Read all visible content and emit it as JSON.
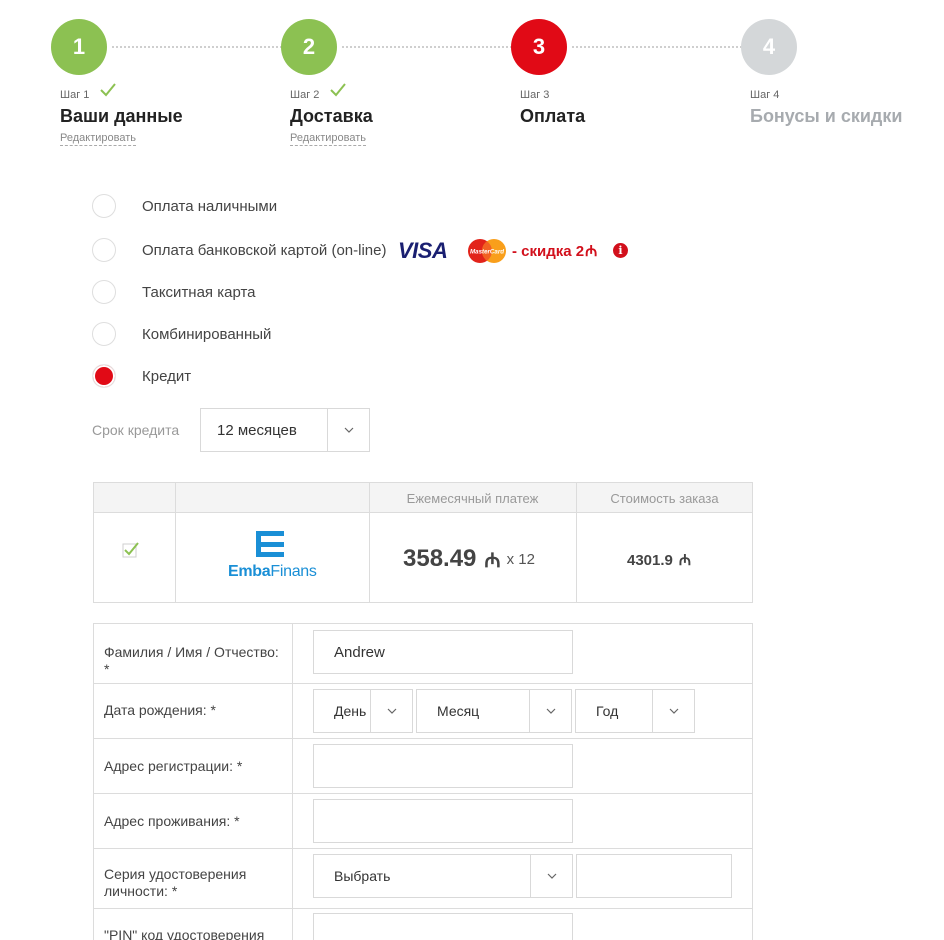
{
  "steps": [
    {
      "number": "1",
      "small": "Шаг 1",
      "title": "Ваши данные",
      "edit": "Редактировать",
      "state": "done"
    },
    {
      "number": "2",
      "small": "Шаг 2",
      "title": "Доставка",
      "edit": "Редактировать",
      "state": "done"
    },
    {
      "number": "3",
      "small": "Шаг 3",
      "title": "Оплата",
      "state": "active"
    },
    {
      "number": "4",
      "small": "Шаг 4",
      "title": "Бонусы и скидки",
      "state": "todo"
    }
  ],
  "payment_options": [
    {
      "label": "Оплата наличными",
      "selected": false
    },
    {
      "label": "Оплата банковской картой (on-line)",
      "selected": false
    },
    {
      "label": "Такситная карта",
      "selected": false
    },
    {
      "label": "Комбинированный",
      "selected": false
    },
    {
      "label": "Кредит",
      "selected": true
    }
  ],
  "card_brands": {
    "visa": "VISA",
    "mastercard": "MasterCard"
  },
  "discount_text": "- скидка 2",
  "currency_symbol": "₼",
  "credit_term": {
    "label": "Срок кредита",
    "value": "12 месяцев"
  },
  "offer_table": {
    "headers": [
      "Ежемесячный платеж",
      "Стоимость заказа"
    ],
    "row": {
      "lender_name_part1": "Emba",
      "lender_name_part2": "Finans",
      "monthly_payment": "358.49",
      "multiplier": "x 12",
      "order_cost": "4301.9"
    }
  },
  "form": {
    "full_name": {
      "label": "Фамилия / Имя / Отчество: *",
      "value": "Andrew"
    },
    "birth_date": {
      "label": "Дата рождения: *",
      "day": "День",
      "month": "Месяц",
      "year": "Год"
    },
    "reg_address": {
      "label": "Адрес регистрации: *",
      "value": ""
    },
    "live_address": {
      "label": "Адрес проживания: *",
      "value": ""
    },
    "id_series": {
      "label": "Серия удостоверения личности: *",
      "select": "Выбрать",
      "value": ""
    },
    "pin": {
      "label": "\"PIN\" код удостоверения"
    }
  },
  "colors": {
    "done": "#8cc152",
    "active": "#e10a16",
    "todo": "#d4d7d9",
    "discount": "#d2101c",
    "brand_blue": "#1a8fd6"
  }
}
